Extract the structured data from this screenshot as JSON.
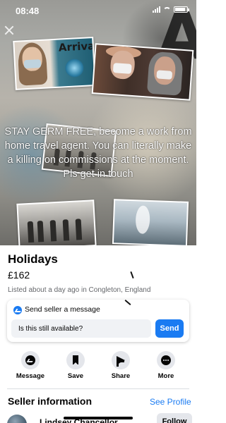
{
  "status_bar": {
    "time": "08:48",
    "battery_level": 0.9
  },
  "close_icon": "close-icon",
  "hero": {
    "photo_sign_text": "Arrivals",
    "overlay_text": "STAY GERM FREE, become a work from home travel agent. You can literally make a killing on commissions at the moment. Pls get in touch",
    "big_letter": "A"
  },
  "listing": {
    "title": "Holidays",
    "price": "£162",
    "meta": "Listed about a day ago in Congleton, England"
  },
  "message_card": {
    "icon": "messenger-icon",
    "heading": "Send seller a message",
    "input_value": "Is this still available?",
    "send_label": "Send"
  },
  "actions": [
    {
      "label": "Message",
      "icon": "messenger-icon"
    },
    {
      "label": "Save",
      "icon": "bookmark-icon"
    },
    {
      "label": "Share",
      "icon": "share-icon"
    },
    {
      "label": "More",
      "icon": "more-icon"
    }
  ],
  "seller": {
    "heading": "Seller information",
    "see_profile_label": "See Profile",
    "name": "Lindsey Chancellor",
    "follow_label": "Follow"
  },
  "colors": {
    "accent": "#1a7bf2",
    "text_primary": "#050505",
    "text_secondary": "#65676b",
    "button_bg": "#e4e6eb",
    "input_bg": "#f0f2f5"
  }
}
